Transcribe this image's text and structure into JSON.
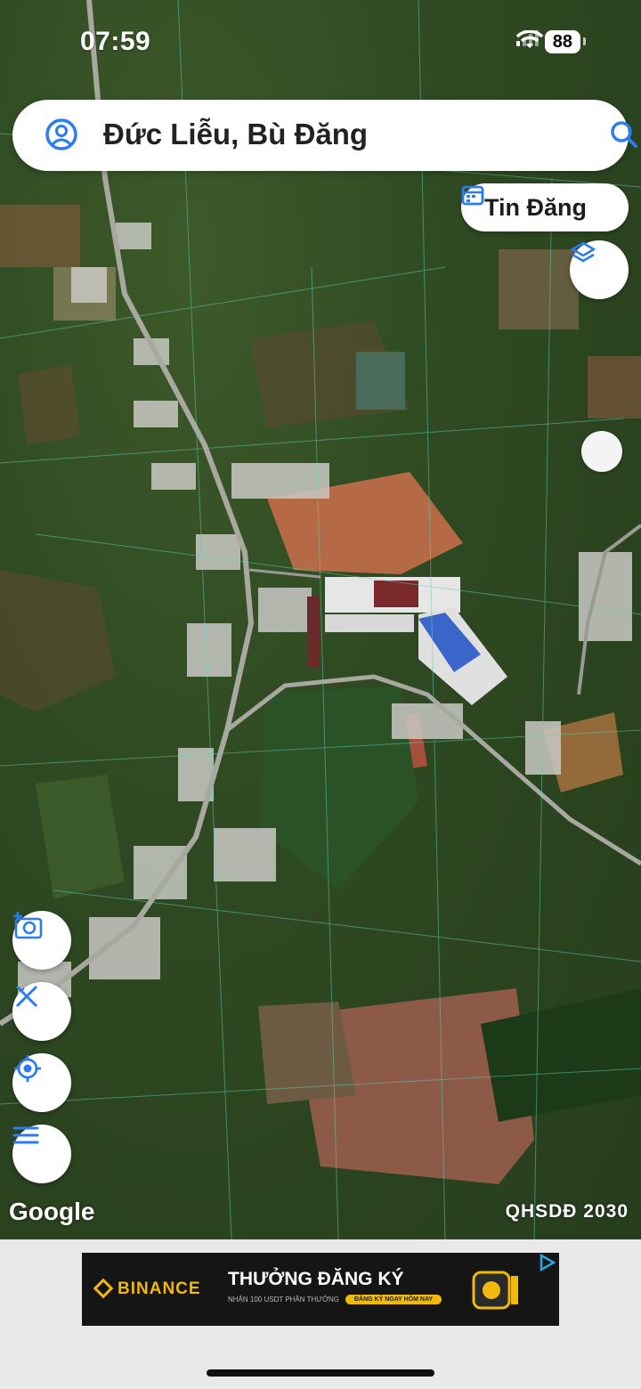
{
  "status_bar": {
    "time": "07:59",
    "battery": "88"
  },
  "search": {
    "title": "Đức Liễu, Bù Đăng"
  },
  "tin_dang": {
    "label": "Tin Đăng"
  },
  "map": {
    "attribution": "Google",
    "label": "QHSDĐ 2030"
  },
  "ad": {
    "brand": "BINANCE",
    "headline": "THƯỞNG ĐĂNG KÝ",
    "sub": "NHẬN 100 USDT PHẦN THƯỞNG",
    "cta": "ĐĂNG KÝ NGAY HÔM NAY"
  },
  "colors": {
    "accent": "#2b7cf0",
    "binance_yellow": "#f0b90b"
  },
  "icons": [
    "user-circle-icon",
    "search-icon",
    "calendar-icon",
    "layers-icon",
    "camera-add-icon",
    "ruler-icon",
    "locate-icon",
    "menu-icon"
  ]
}
